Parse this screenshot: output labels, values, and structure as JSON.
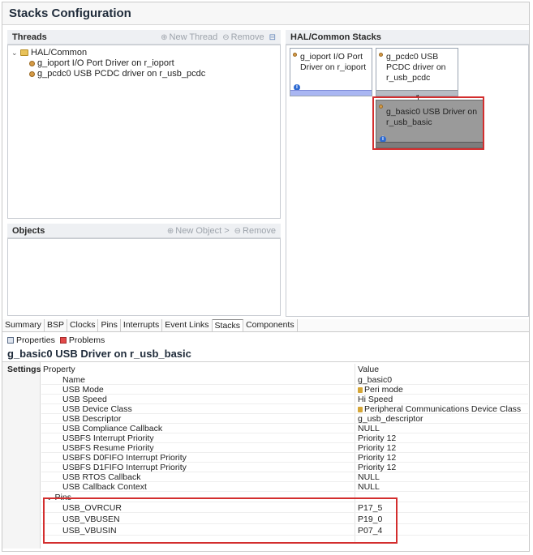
{
  "title": "Stacks Configuration",
  "threads": {
    "header": "Threads",
    "new_thread": "New Thread",
    "remove": "Remove",
    "tree": {
      "root": "HAL/Common",
      "children": [
        "g_ioport I/O Port Driver on r_ioport",
        "g_pcdc0 USB PCDC driver on r_usb_pcdc"
      ]
    }
  },
  "objects": {
    "header": "Objects",
    "new_object": "New Object >",
    "remove": "Remove"
  },
  "stacks": {
    "header": "HAL/Common Stacks",
    "cards": [
      {
        "label": "g_ioport I/O Port Driver on r_ioport"
      },
      {
        "label": "g_pcdc0 USB PCDC driver on r_usb_pcdc"
      },
      {
        "label": "g_basic0 USB Driver on r_usb_basic"
      }
    ]
  },
  "bottom_tabs": [
    "Summary",
    "BSP",
    "Clocks",
    "Pins",
    "Interrupts",
    "Event Links",
    "Stacks",
    "Components"
  ],
  "active_bottom_tab": "Stacks",
  "views": {
    "properties": "Properties",
    "problems": "Problems"
  },
  "selected_title": "g_basic0 USB Driver on r_usb_basic",
  "settings_tab": "Settings",
  "props": {
    "header_property": "Property",
    "header_value": "Value",
    "rows": [
      {
        "name": "Name",
        "value": "g_basic0"
      },
      {
        "name": "USB Mode",
        "value": "Peri mode"
      },
      {
        "name": "USB Speed",
        "value": "Hi Speed"
      },
      {
        "name": "USB Device Class",
        "value": "Peripheral Communications Device Class"
      },
      {
        "name": "USB Descriptor",
        "value": "g_usb_descriptor"
      },
      {
        "name": "USB Compliance Callback",
        "value": "NULL"
      },
      {
        "name": "USBFS Interrupt Priority",
        "value": "Priority 12"
      },
      {
        "name": "USBFS Resume Priority",
        "value": "Priority 12"
      },
      {
        "name": "USBFS D0FIFO Interrupt Priority",
        "value": "Priority 12"
      },
      {
        "name": "USBFS D1FIFO Interrupt Priority",
        "value": "Priority 12"
      },
      {
        "name": "USB RTOS Callback",
        "value": "NULL"
      },
      {
        "name": "USB Callback Context",
        "value": "NULL"
      }
    ],
    "pins_group": "Pins",
    "pins": [
      {
        "name": "USB_OVRCUR",
        "value": "P17_5"
      },
      {
        "name": "USB_VBUSEN",
        "value": "P19_0"
      },
      {
        "name": "USB_VBUSIN",
        "value": "P07_4"
      }
    ]
  },
  "colors": {
    "highlight_outline": "#d32e2e",
    "selected_card": "#9a9a9a"
  },
  "icons": {
    "thread_add": "new-thread-icon",
    "remove": "remove-icon",
    "collapse": "collapse-icon",
    "info": "info-icon",
    "lock": "lock-icon"
  }
}
